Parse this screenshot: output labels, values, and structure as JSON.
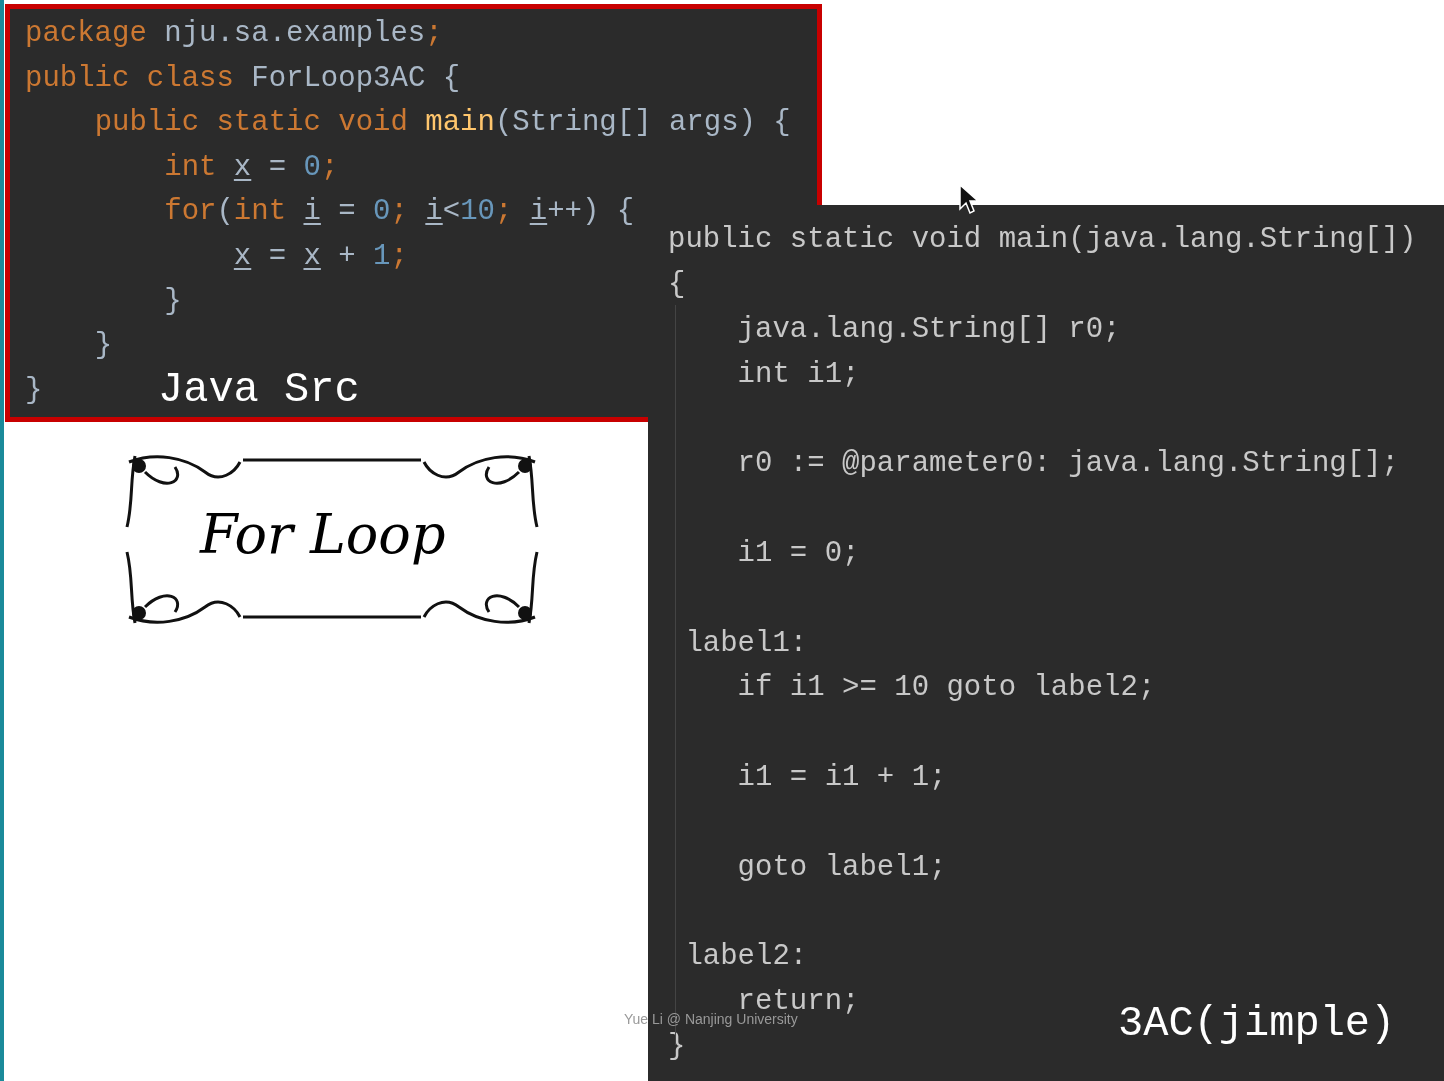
{
  "java_src": {
    "label": "Java Src",
    "lines": [
      [
        {
          "text": "package ",
          "kind": "keyword"
        },
        {
          "text": "nju.sa.examples",
          "kind": "plain"
        },
        {
          "text": ";",
          "kind": "keyword"
        }
      ],
      [
        {
          "text": "public class ",
          "kind": "keyword"
        },
        {
          "text": "ForLoop3AC {",
          "kind": "plain"
        }
      ],
      [
        {
          "text": "    public static void ",
          "kind": "keyword"
        },
        {
          "text": "main",
          "kind": "method"
        },
        {
          "text": "(String[] args) {",
          "kind": "plain"
        }
      ],
      [
        {
          "text": "        int ",
          "kind": "keyword"
        },
        {
          "text": "x",
          "kind": "local"
        },
        {
          "text": " = ",
          "kind": "plain"
        },
        {
          "text": "0",
          "kind": "number"
        },
        {
          "text": ";",
          "kind": "keyword"
        }
      ],
      [
        {
          "text": "        for",
          "kind": "keyword"
        },
        {
          "text": "(",
          "kind": "plain"
        },
        {
          "text": "int ",
          "kind": "keyword"
        },
        {
          "text": "i",
          "kind": "local"
        },
        {
          "text": " = ",
          "kind": "plain"
        },
        {
          "text": "0",
          "kind": "number"
        },
        {
          "text": "; ",
          "kind": "keyword"
        },
        {
          "text": "i",
          "kind": "local"
        },
        {
          "text": "<",
          "kind": "plain"
        },
        {
          "text": "10",
          "kind": "number"
        },
        {
          "text": "; ",
          "kind": "keyword"
        },
        {
          "text": "i",
          "kind": "local"
        },
        {
          "text": "++) {",
          "kind": "plain"
        }
      ],
      [
        {
          "text": "            x",
          "kind": "local"
        },
        {
          "text": " = ",
          "kind": "plain"
        },
        {
          "text": "x",
          "kind": "local"
        },
        {
          "text": " + ",
          "kind": "plain"
        },
        {
          "text": "1",
          "kind": "number"
        },
        {
          "text": ";",
          "kind": "keyword"
        }
      ],
      [
        {
          "text": "        }",
          "kind": "plain"
        }
      ],
      [
        {
          "text": "    }",
          "kind": "plain"
        }
      ],
      [
        {
          "text": "}",
          "kind": "plain"
        }
      ]
    ]
  },
  "title_ornament": {
    "text": "For Loop"
  },
  "jimple": {
    "label": "3AC(jimple)",
    "lines": [
      {
        "kind": "code",
        "text": "public static void main(java.lang.String[])"
      },
      {
        "kind": "code",
        "text": "{"
      },
      {
        "kind": "code",
        "text": "    java.lang.String[] r0;"
      },
      {
        "kind": "code",
        "text": "    int i1;"
      },
      {
        "kind": "blank"
      },
      {
        "kind": "code",
        "text": "    r0 := @parameter0: java.lang.String[];"
      },
      {
        "kind": "blank"
      },
      {
        "kind": "code",
        "text": "    i1 = 0;"
      },
      {
        "kind": "blank"
      },
      {
        "kind": "code",
        "text": " label1:"
      },
      {
        "kind": "code",
        "text": "    if i1 >= 10 goto label2;"
      },
      {
        "kind": "blank"
      },
      {
        "kind": "code",
        "text": "    i1 = i1 + 1;"
      },
      {
        "kind": "blank"
      },
      {
        "kind": "code",
        "text": "    goto label1;"
      },
      {
        "kind": "blank"
      },
      {
        "kind": "code",
        "text": " label2:"
      },
      {
        "kind": "code",
        "text": "    return;"
      },
      {
        "kind": "code",
        "text": "}"
      }
    ]
  },
  "caption": "Yue Li @ Nanjing University"
}
